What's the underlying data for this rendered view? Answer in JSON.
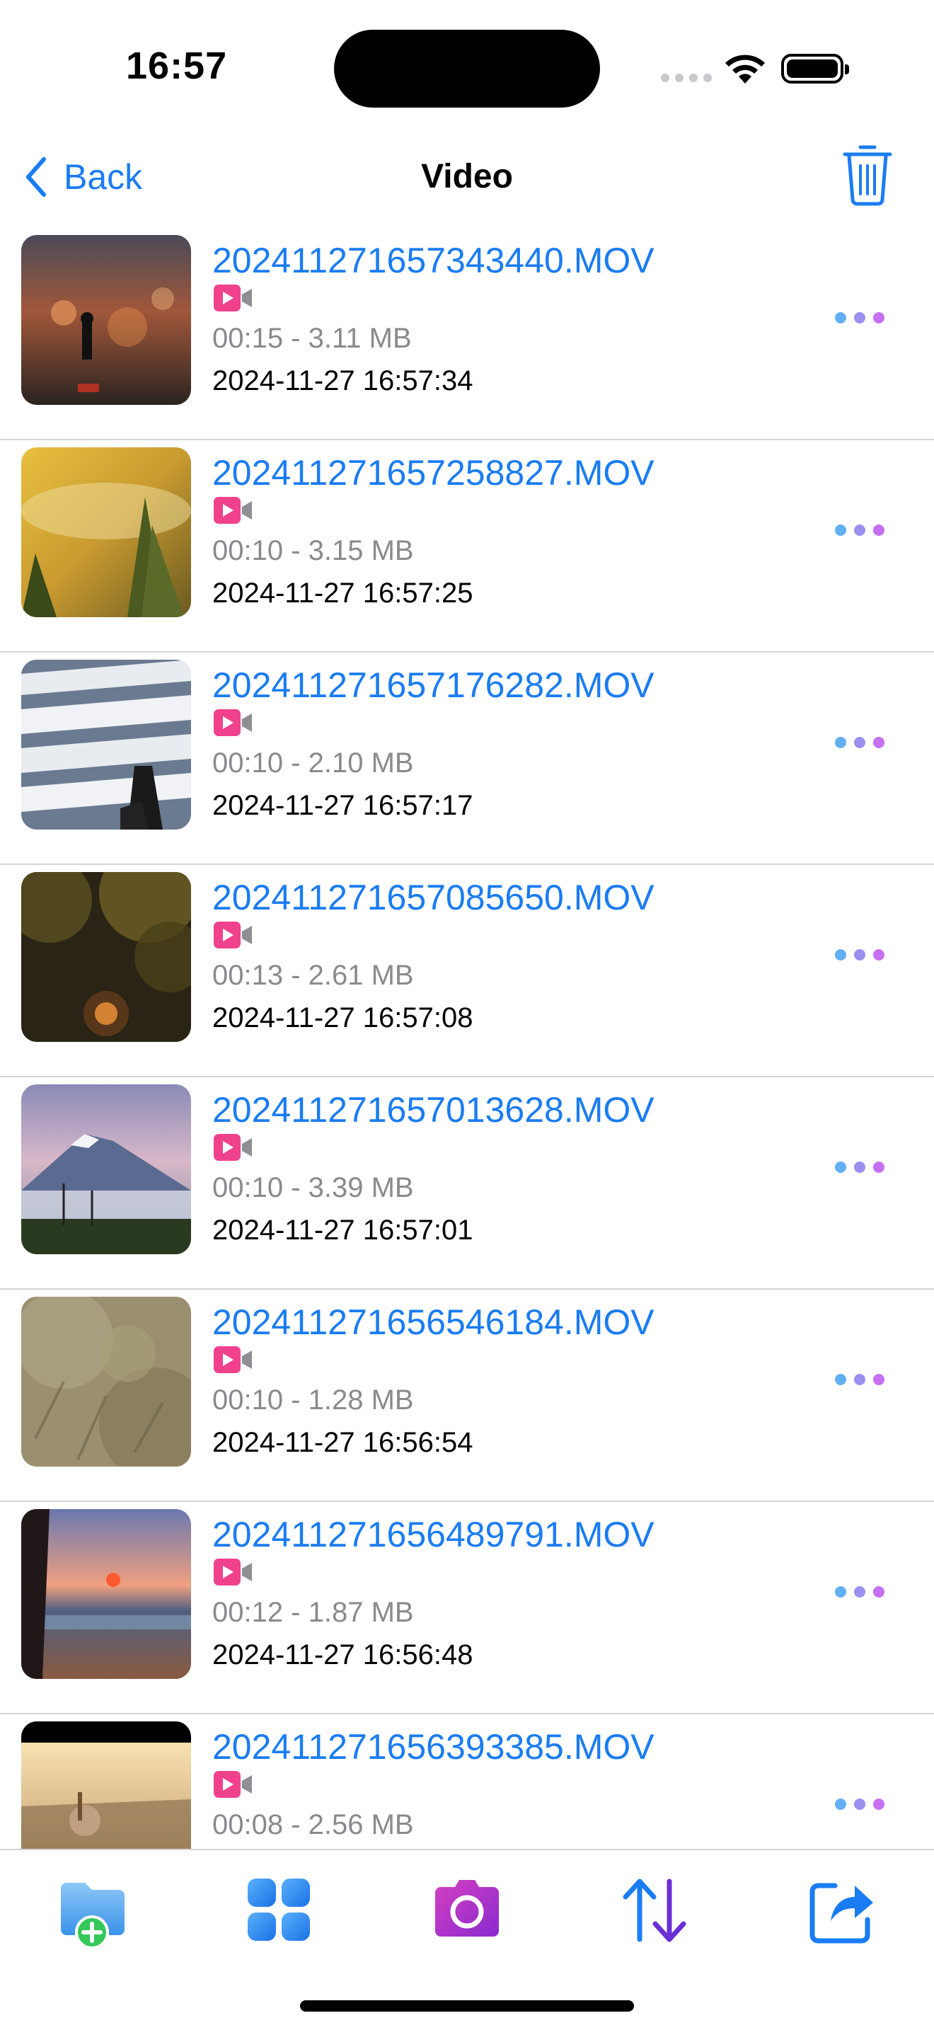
{
  "status_bar": {
    "time": "16:57"
  },
  "nav": {
    "back_label": "Back",
    "title": "Video"
  },
  "files": [
    {
      "name": "202411271657343440.MOV",
      "meta": "00:15 - 3.11 MB",
      "date": "2024-11-27 16:57:34"
    },
    {
      "name": "202411271657258827.MOV",
      "meta": "00:10 - 3.15 MB",
      "date": "2024-11-27 16:57:25"
    },
    {
      "name": "202411271657176282.MOV",
      "meta": "00:10 - 2.10 MB",
      "date": "2024-11-27 16:57:17"
    },
    {
      "name": "202411271657085650.MOV",
      "meta": "00:13 - 2.61 MB",
      "date": "2024-11-27 16:57:08"
    },
    {
      "name": "202411271657013628.MOV",
      "meta": "00:10 - 3.39 MB",
      "date": "2024-11-27 16:57:01"
    },
    {
      "name": "202411271656546184.MOV",
      "meta": "00:10 - 1.28 MB",
      "date": "2024-11-27 16:56:54"
    },
    {
      "name": "202411271656489791.MOV",
      "meta": "00:12 - 1.87 MB",
      "date": "2024-11-27 16:56:48"
    },
    {
      "name": "202411271656393385.MOV",
      "meta": "00:08 - 2.56 MB",
      "date": ""
    }
  ],
  "tab_bar": {
    "items": [
      {
        "icon": "folder-add-icon"
      },
      {
        "icon": "grid-icon"
      },
      {
        "icon": "camera-icon"
      },
      {
        "icon": "sort-icon"
      },
      {
        "icon": "share-icon"
      }
    ]
  },
  "colors": {
    "accent": "#1a7cf2",
    "video_badge": "#f0418c",
    "camera": "#b02fc9",
    "sort_up": "#1a7cf2",
    "sort_down": "#6b2fd6"
  }
}
